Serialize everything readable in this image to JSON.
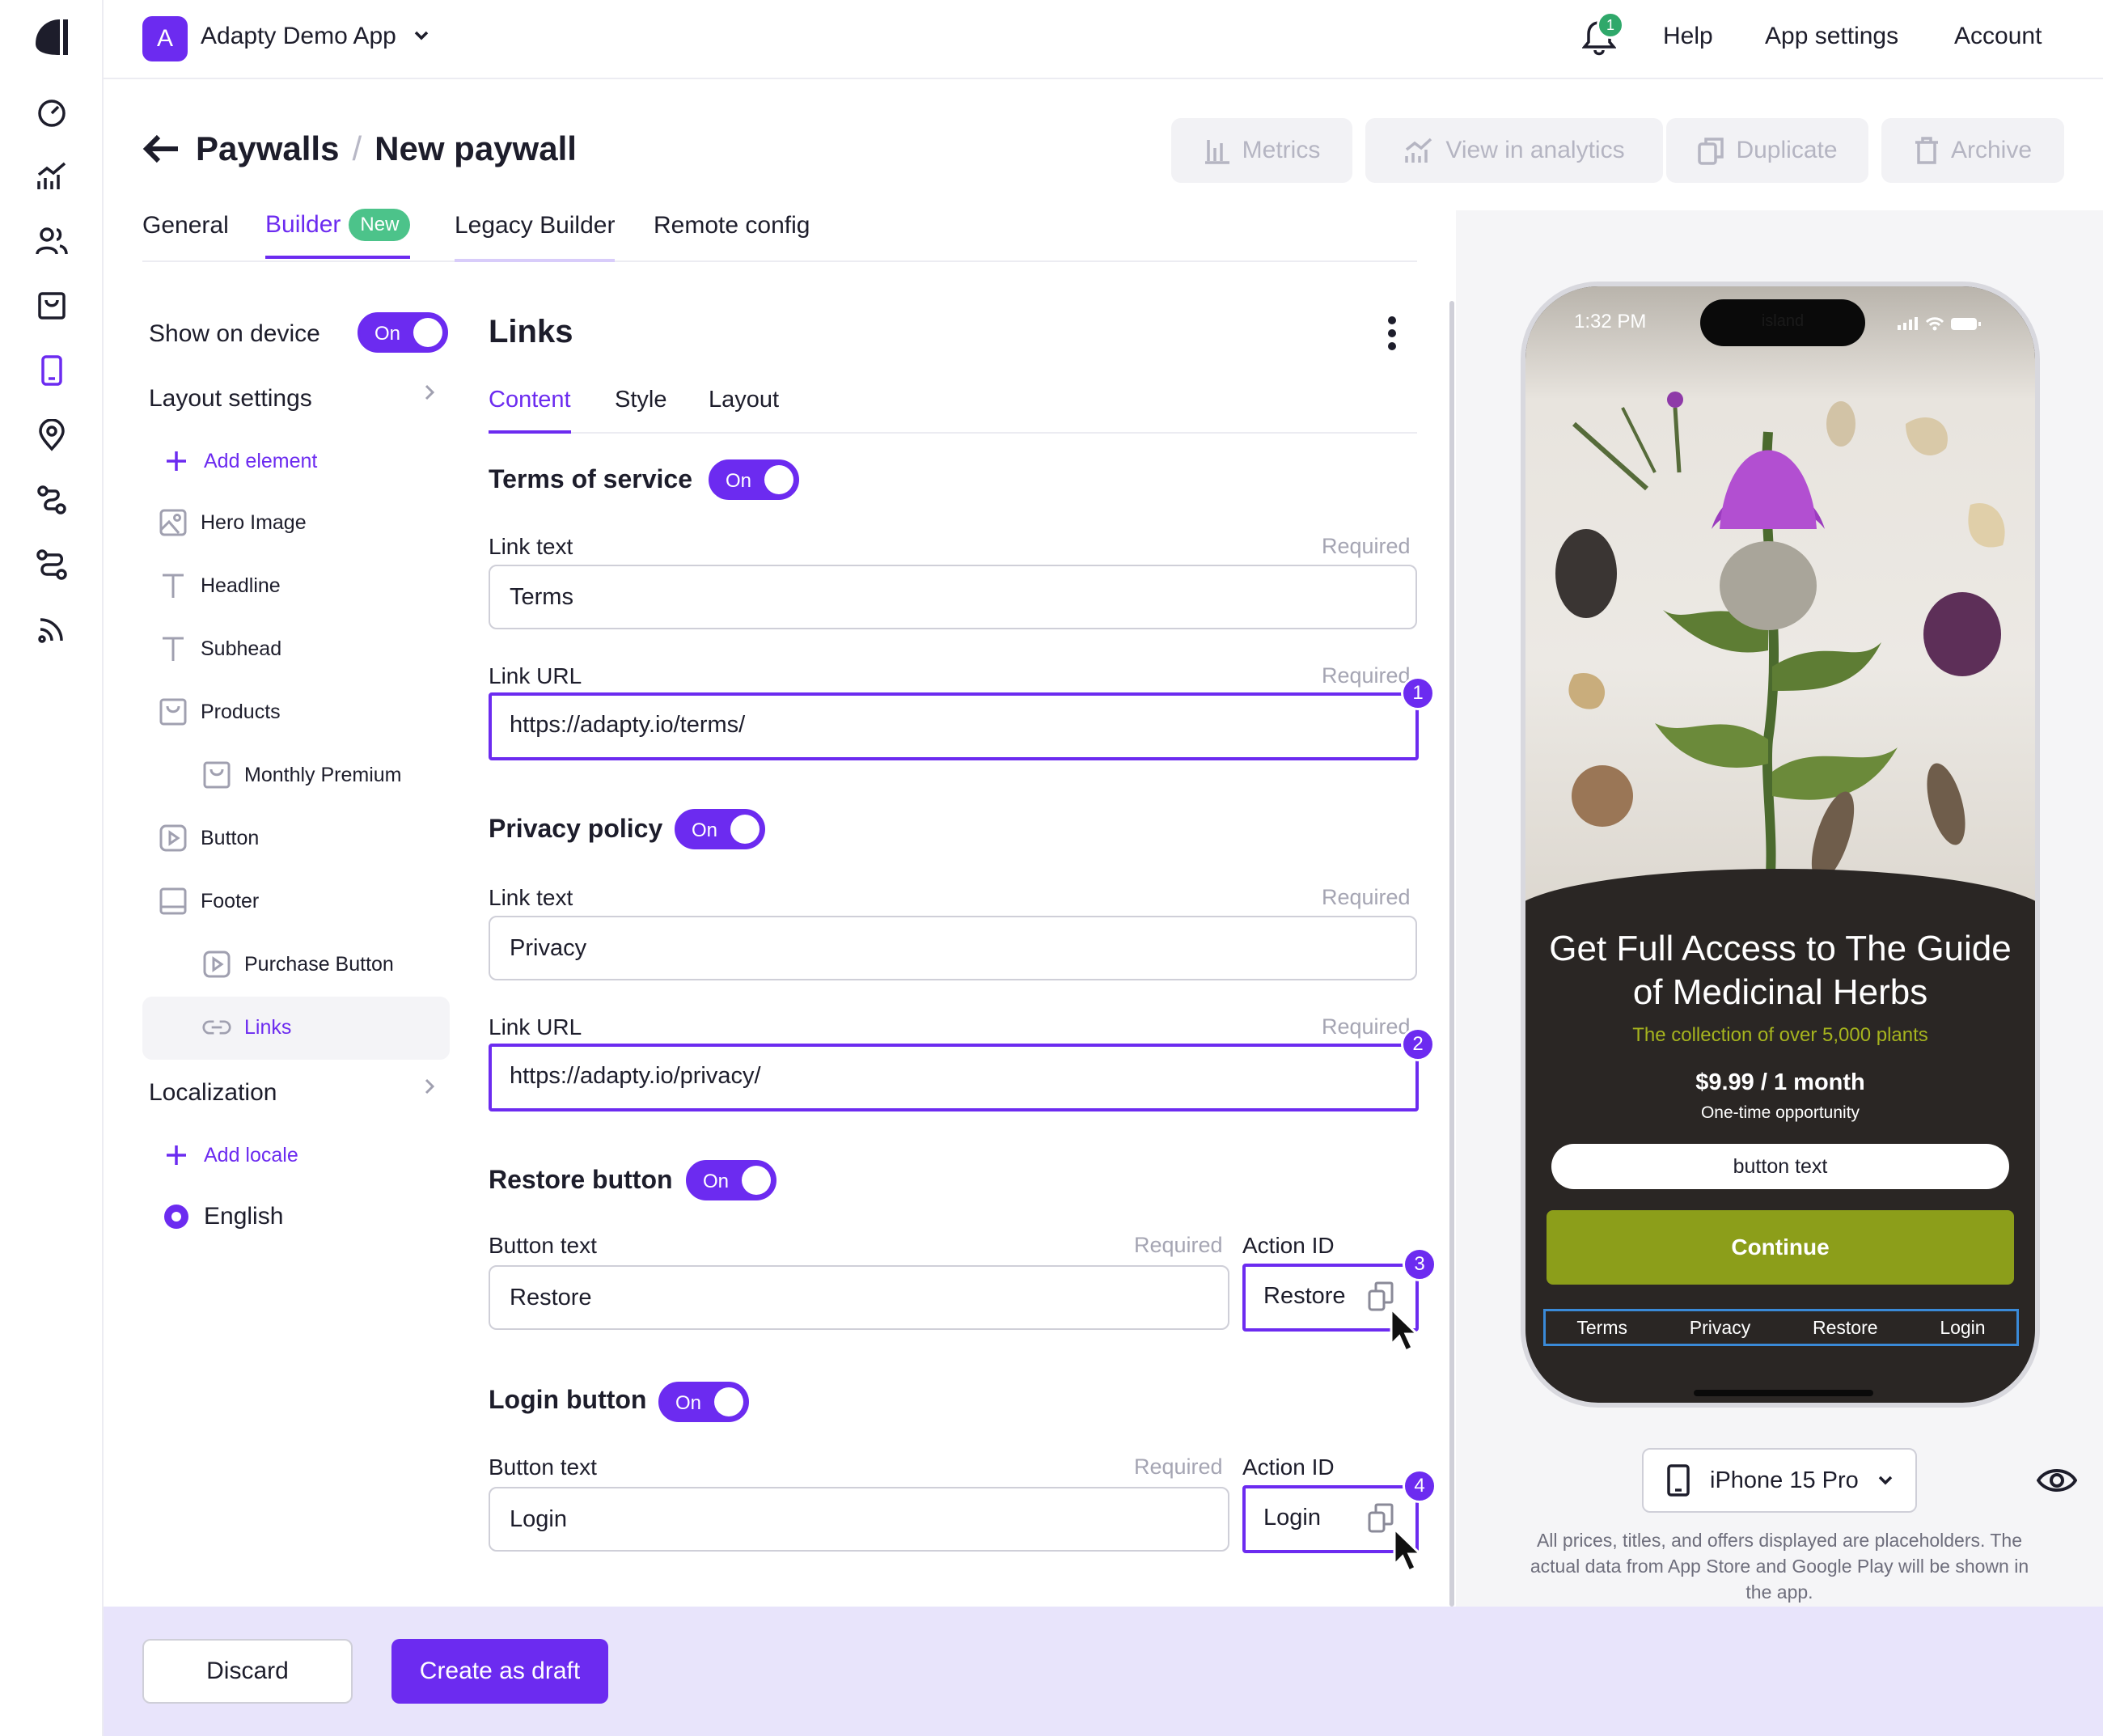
{
  "header": {
    "app_initial": "A",
    "app_name": "Adapty Demo App",
    "notification_count": "1",
    "help": "Help",
    "app_settings": "App settings",
    "account": "Account"
  },
  "breadcrumb": {
    "parent": "Paywalls",
    "separator": "/",
    "current": "New paywall"
  },
  "actions": {
    "metrics": "Metrics",
    "view_in_analytics": "View in analytics",
    "duplicate": "Duplicate",
    "archive": "Archive"
  },
  "tabs": {
    "general": "General",
    "builder": "Builder",
    "new_badge": "New",
    "legacy_builder": "Legacy Builder",
    "remote_config": "Remote config"
  },
  "tree": {
    "show_on_device": "Show on device",
    "show_on_device_state": "On",
    "layout_settings": "Layout settings",
    "add_element": "Add element",
    "items": [
      {
        "label": "Hero Image",
        "icon": "image-icon"
      },
      {
        "label": "Headline",
        "icon": "text-icon"
      },
      {
        "label": "Subhead",
        "icon": "text-icon"
      },
      {
        "label": "Products",
        "icon": "products-icon"
      },
      {
        "label": "Monthly Premium",
        "icon": "product-icon"
      },
      {
        "label": "Button",
        "icon": "play-icon"
      },
      {
        "label": "Footer",
        "icon": "footer-icon"
      },
      {
        "label": "Purchase Button",
        "icon": "play-icon"
      },
      {
        "label": "Links",
        "icon": "link-icon"
      }
    ],
    "localization": "Localization",
    "add_locale": "Add locale",
    "locale": "English"
  },
  "editor": {
    "title": "Links",
    "subtabs": [
      "Content",
      "Style",
      "Layout"
    ],
    "terms": {
      "title": "Terms of service",
      "state": "On",
      "link_text_label": "Link text",
      "link_text_required": "Required",
      "link_text_value": "Terms",
      "link_url_label": "Link URL",
      "link_url_required": "Required",
      "link_url_value": "https://adapty.io/terms/",
      "marker": "1"
    },
    "privacy": {
      "title": "Privacy policy",
      "state": "On",
      "link_text_label": "Link text",
      "link_text_required": "Required",
      "link_text_value": "Privacy",
      "link_url_label": "Link URL",
      "link_url_required": "Required",
      "link_url_value": "https://adapty.io/privacy/",
      "marker": "2"
    },
    "restore": {
      "title": "Restore button",
      "state": "On",
      "button_text_label": "Button text",
      "button_text_required": "Required",
      "button_text_value": "Restore",
      "action_id_label": "Action ID",
      "action_id_value": "Restore",
      "marker": "3"
    },
    "login": {
      "title": "Login button",
      "state": "On",
      "button_text_label": "Button text",
      "button_text_required": "Required",
      "button_text_value": "Login",
      "action_id_label": "Action ID",
      "action_id_value": "Login",
      "marker": "4"
    }
  },
  "preview": {
    "time": "1:32 PM",
    "island": "island",
    "headline": "Get Full Access to The Guide of Medicinal Herbs",
    "subhead": "The collection of over 5,000 plants",
    "price": "$9.99 / 1 month",
    "price_note": "One-time opportunity",
    "button_text": "button text",
    "continue": "Continue",
    "links": [
      "Terms",
      "Privacy",
      "Restore",
      "Login"
    ],
    "device": "iPhone 15 Pro",
    "disclaimer": "All prices, titles, and offers displayed are placeholders. The actual data from App Store and Google Play will be shown in the app."
  },
  "footer": {
    "discard": "Discard",
    "create_draft": "Create as draft"
  },
  "colors": {
    "accent": "#6c2bf0",
    "badge_green": "#4cc38a",
    "continue_green": "#8c9e1a",
    "phone_dark": "#2a2624"
  }
}
